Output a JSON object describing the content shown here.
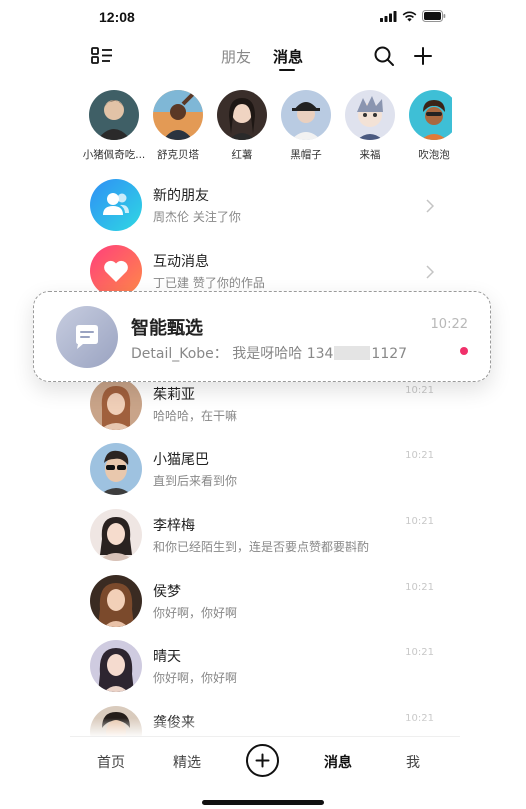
{
  "status_bar": {
    "time": "12:08"
  },
  "top_nav": {
    "tabs": [
      {
        "label": "朋友"
      },
      {
        "label": "消息"
      }
    ],
    "active_tab": "消息"
  },
  "stories": [
    {
      "name": "小猪佩奇吃...",
      "color": "#4b6b73"
    },
    {
      "name": "舒克贝塔",
      "color": "#c7773a"
    },
    {
      "name": "红薯",
      "color": "#6d4a3c"
    },
    {
      "name": "黑帽子",
      "color": "#8fa7c9"
    },
    {
      "name": "来福",
      "color": "#d9dbe8"
    },
    {
      "name": "吹泡泡",
      "color": "#45c0d6"
    }
  ],
  "system_rows": [
    {
      "title": "新的朋友",
      "subtitle": "周杰伦 关注了你",
      "icon": "friends-icon",
      "gradient": [
        "#38a3f5",
        "#2fd4e0"
      ]
    },
    {
      "title": "互动消息",
      "subtitle": "丁已建 赞了你的作品",
      "icon": "heart-icon",
      "gradient": [
        "#ff4b78",
        "#ff8a4c"
      ]
    }
  ],
  "floating_card": {
    "title": "智能甄选",
    "sender": "Detail_Kobe：",
    "message_start": "我是呀哈哈 134",
    "message_end": "1127",
    "time": "10:22",
    "unread_color": "#f0306a"
  },
  "chats": [
    {
      "name": "茱莉亚",
      "message": "哈哈哈，在干嘛",
      "time": "10:21",
      "avatar_color": "#b97a5a"
    },
    {
      "name": "小猫尾巴",
      "message": "直到后来看到你",
      "time": "10:21",
      "avatar_color": "#7fa3c4"
    },
    {
      "name": "李梓梅",
      "message": "和你已经陌生到，连是否要点赞都要斟酌",
      "time": "10:21",
      "avatar_color": "#e3c9c1"
    },
    {
      "name": "侯梦",
      "message": "你好啊，你好啊",
      "time": "10:21",
      "avatar_color": "#c78a5e"
    },
    {
      "name": "晴天",
      "message": "你好啊，你好啊",
      "time": "10:21",
      "avatar_color": "#a4a0c4"
    },
    {
      "name": "龚俊来",
      "message": "",
      "time": "10:21",
      "avatar_color": "#6b5a4c"
    }
  ],
  "bottom_nav": {
    "home": "首页",
    "featured": "精选",
    "messages": "消息",
    "me": "我"
  }
}
